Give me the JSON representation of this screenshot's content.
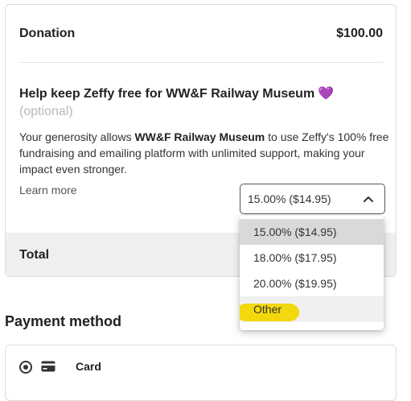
{
  "summary": {
    "donation_label": "Donation",
    "donation_amount": "$100.00",
    "total_label": "Total"
  },
  "tip": {
    "title": "Help keep Zeffy free for WW&F Railway Museum",
    "heart": "💜",
    "optional": "(optional)",
    "desc_prefix": "Your generosity allows ",
    "desc_org": "WW&F Railway Museum",
    "desc_suffix": " to use Zeffy's 100% free fundraising and emailing platform with unlimited support, making your impact even stronger.",
    "learn_more": "Learn more",
    "selected_value": "15.00% ($14.95)",
    "options": [
      "15.00% ($14.95)",
      "18.00% ($17.95)",
      "20.00% ($19.95)",
      "Other"
    ]
  },
  "payment": {
    "title": "Payment method",
    "card_label": "Card"
  },
  "colors": {
    "heart": "#8b3fd9",
    "highlight": "#f2d600",
    "total_band": "#efefef"
  }
}
